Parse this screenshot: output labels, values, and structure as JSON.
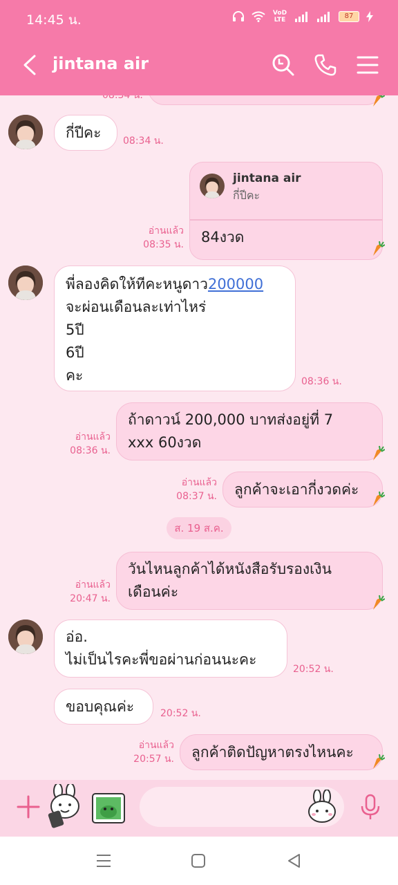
{
  "status_bar": {
    "time": "14:45 น.",
    "network": "VoD LTE",
    "battery": "87"
  },
  "header": {
    "contact_name": "jintana air"
  },
  "messages": [
    {
      "text": "กี่ปีคะ",
      "time": "08:34 น."
    },
    {
      "quote_name": "jintana air",
      "quote_text": "กี่ปีคะ",
      "text": "84งวด",
      "read": "อ่านแล้ว",
      "time": "08:35 น."
    },
    {
      "line1": "พี่ลองคิดให้ทีคะหนูดาว",
      "link": "200000",
      "line2": "จะผ่อนเดือนละเท่าไหร่",
      "line3": "5ปี",
      "line4": "6ปี",
      "line5": "คะ",
      "time": "08:36 น."
    },
    {
      "line1": "ถ้าดาวน์ 200,000 บาทส่งอยู่ที่ 7",
      "line2": "xxx 60งวด",
      "read": "อ่านแล้ว",
      "time": "08:36 น."
    },
    {
      "text": "ลูกค้าจะเอากี่งวดค่ะ",
      "read": "อ่านแล้ว",
      "time": "08:37 น."
    },
    {
      "line1": "วันไหนลูกค้าได้หนังสือรับรองเงิน",
      "line2": "เดือนค่ะ",
      "read": "อ่านแล้ว",
      "time": "20:47 น."
    },
    {
      "line1": "อ่อ.",
      "line2": "ไม่เป็นไรคะพี่ขอผ่านก่อนนะคะ",
      "time": "20:52 น."
    },
    {
      "text": "ขอบคุณค่ะ",
      "time": "20:52 น."
    },
    {
      "text": "ลูกค้าติดปัญหาตรงไหนคะ",
      "read": "อ่านแล้ว",
      "time": "20:57 น."
    }
  ],
  "partial_top_time": "08:34 น.",
  "date_separator": "ส. 19 ส.ค."
}
